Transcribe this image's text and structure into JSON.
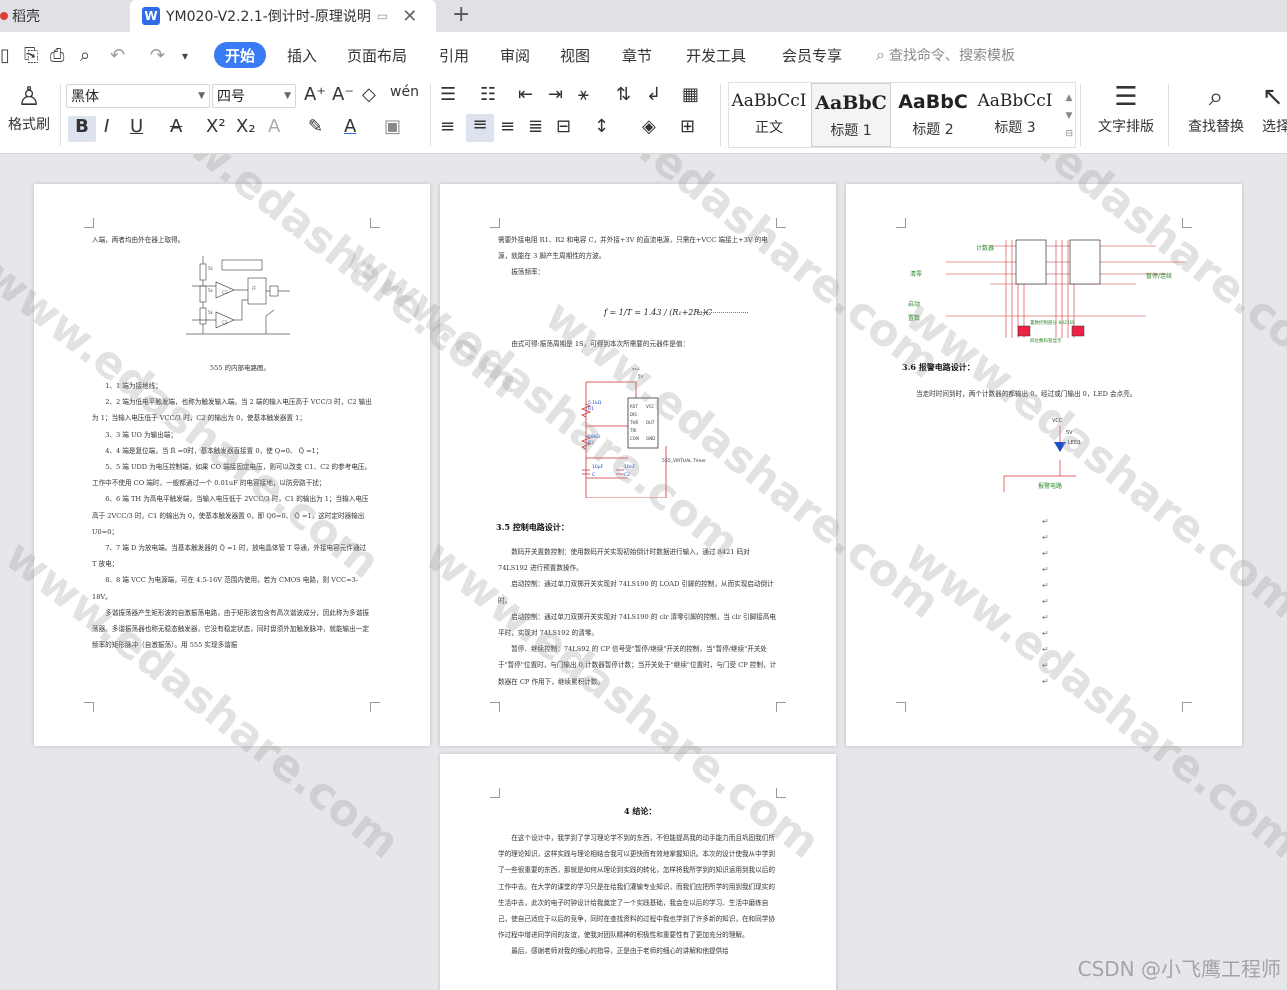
{
  "tabs": [
    {
      "label": "稻壳"
    },
    {
      "label": "YM020-V2.2.1-倒计时-原理说明"
    }
  ],
  "menu": {
    "items": [
      "开始",
      "插入",
      "页面布局",
      "引用",
      "审阅",
      "视图",
      "章节",
      "开发工具",
      "会员专享"
    ],
    "search_placeholder": "查找命令、搜索模板"
  },
  "toolbar": {
    "format_brush": "格式刷",
    "font": "黑体",
    "size": "四号",
    "styles": [
      {
        "sample": "AaBbCcI",
        "name": "正文"
      },
      {
        "sample": "AaBbC",
        "name": "标题 1"
      },
      {
        "sample": "AaBbC",
        "name": "标题 2"
      },
      {
        "sample": "AaBbCcI",
        "name": "标题 3"
      }
    ],
    "text_layout": "文字排版",
    "find_replace": "查找替换",
    "select": "选择"
  },
  "page1": {
    "intro": "入端，两者均由外在器上取得。",
    "caption": "555 的内部电路图。",
    "paragraphs": [
      "1、1 端为接地线；",
      "2、2 端为低电平触发端，也称为触发输入端。当 2 端的输入电压高于 VCC/3 时，C2 输出为 1；当输入电压低于 VCC/3 时，C2 的输出为 0，使基本触发器置 1；",
      "3、3 端 UO 为输出端；",
      "4、4 端是复位端，当 R̄ =0时，基本触发器直接置 0，使 Q=0、 Q̄ =1；",
      "5、5 端 UDD 为电压控制端，如果 CO 端接固定电压，则可以改变 C1、C2 的参考电压。工作中不使用 CO 端时，一般都通过一个 0.01uF 的电容接地，以防旁路干扰；",
      "6、6 端 TH 为高电平触发端，当输入电压低于 2VCC/3 时，C1 的输出为 1；当输入电压高于 2VCC/3 时，C1 的输出为 0，使基本触发器置 0，即 Q0=0、 Q̄ =1，这时定时器输出 U0=0；",
      "7、7 端 D 为放电端。当基本触发器的 Q̄ =1 时，放电晶体管 T 导通，外接电容元件通过 T 放电；",
      "8、8 端 VCC 为电源端，可在 4.5-16V 范围内使用，若为 CMOS 电路，则 VCC=3-18V。",
      "多谐振荡器产生矩形波的自激振荡电路，由于矩形波包含有高次谐波成分，因此称为多谐振荡器。多谐振荡器也称无稳态触发器，它没有稳定状态，同时毋须外加触发脉冲，就能输出一定频率的矩形脉冲（自激振荡）。用 555 实现多谐振"
    ]
  },
  "page2": {
    "intro": "需要外接电阻 R1、R2 和电容 C，并外接+3V 的直流电源，只需在+VCC 端接上+3V 的电源，就能在 3 脚产生周期性的方波。",
    "freq_label": "振荡频率：",
    "formula": "f = 1/T = 1.43 / (R₁+2R₂)C",
    "period_text": "由式可得:振荡周期是 1S，可得到本次所需要的元器件是值：",
    "timer_label": "555_VIRTUAL Timer",
    "heading": "3.5 控制电路设计：",
    "paragraphs": [
      "数码开关置数控制：使用数码开关实现初始倒计时数据进行输入，通过 8421 码对 74LS192 进行预置数操作。",
      "启动控制：通过单刀双掷开关实现对 74LS190 的 LOAD 引脚的控制，从而实现启动倒计时。",
      "启动控制：通过单刀双掷开关实现对 74LS190 的 clr 清零引脚的控制，当 clr 引脚接高电平时，实现对 74LS192 的清零。",
      "暂停、继续控制：74LS92 的 CP 信号受\"暂停/继续\"开关的控制，当\"暂停/继续\"开关处于\"暂停\"位置时，与门输出 0,计数器暂停计数；当开关处于\"继续\"位置时，与门受 CP 控制，计数器在 CP 作用下，继续累积计数。"
    ]
  },
  "page3": {
    "labels": [
      "清零",
      "启动",
      "置数",
      "计数器",
      "暂停/连续",
      "置数控制部分 8421码",
      "四位数码管显示"
    ],
    "heading": "3.6 报警电路设计：",
    "text": "当走时时间到时，两个计数器的都输出 0，经过或门输出 0，LED 会点亮。",
    "alarm_label": "报警电路",
    "vcc": "VCC",
    "volt": "5V",
    "led": "LED1"
  },
  "page4": {
    "heading": "4 结论：",
    "paragraphs": [
      "在这个设计中，我学到了学习理论学不到的东西，不但能提高我的动手能力而且巩固我们所学的理论知识，这样实践与理论相结合我可以更快而有效地掌握知识。本次的设计使我从中学到了一些很重要的东西，那就是如何从理论到实践的转化，怎样将我所学到的知识运用到我以后的工作中去。在大学的课堂的学习只是在给我们灌输专业知识，而我们应把所学的用到我们现实的生活中去，此次的电子时钟设计给我奠定了一个实践基础，我会在以后的学习、生活中磨练自己，使自己适应于以后的竞争，同时在查找资料的过程中我也学到了许多新的知识，在和同学协作过程中增进同学间的友谊，使我对团队精神的积极性和重要性有了更加充分的理解。",
      "最后，感谢老师对我的细心的指导，正是由于老师的细心的讲解和他提供给"
    ]
  },
  "watermark": "www.edashare.com",
  "csdn": "CSDN @小飞鹰工程师"
}
